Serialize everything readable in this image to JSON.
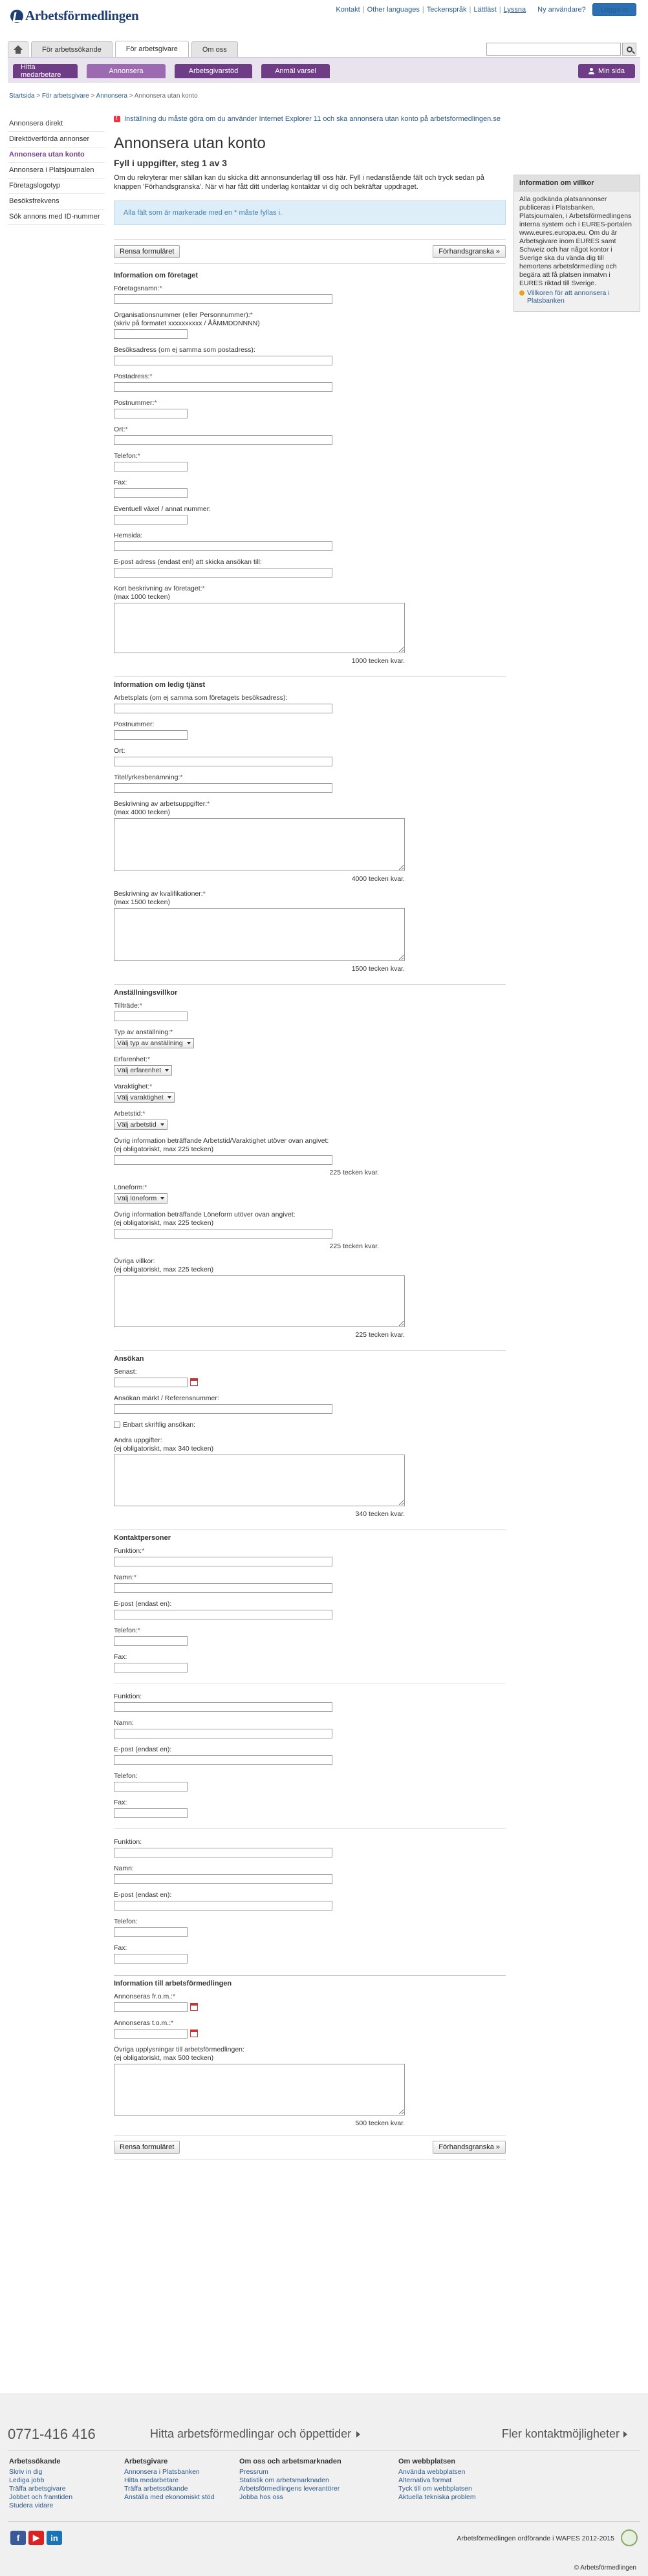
{
  "header": {
    "logo": "Arbetsförmedlingen",
    "links": [
      "Kontakt",
      "Other languages",
      "Teckenspråk",
      "Lättläst",
      "Lyssna"
    ],
    "user_link": "Ny användare?",
    "login": "Logga in"
  },
  "tabs": [
    {
      "label": "För arbetssökande"
    },
    {
      "label": "För arbetsgivare"
    },
    {
      "label": "Om oss"
    }
  ],
  "purple_nav": [
    "Hitta medarbetare",
    "Annonsera",
    "Arbetsgivarstöd",
    "Anmäl varsel"
  ],
  "mina_sida": "Min sida",
  "breadcrumb": [
    "Startsida",
    "För arbetsgivare",
    "Annonsera",
    "Annonsera utan konto"
  ],
  "sidebar": {
    "items": [
      {
        "label": "Annonsera direkt"
      },
      {
        "label": "Direktöverförda annonser"
      },
      {
        "label": "Annonsera utan konto"
      },
      {
        "label": "Annonsera i Platsjournalen"
      },
      {
        "label": "Företagslogotyp"
      },
      {
        "label": "Besöksfrekvens"
      },
      {
        "label": "Sök annons med ID-nummer"
      }
    ]
  },
  "ie_notice": "Inställning du måste göra om du använder Internet Explorer 11 och ska annonsera utan konto på arbetsformedlingen.se",
  "page": {
    "title": "Annonsera utan konto",
    "step": "Fyll i uppgifter, steg 1 av 3",
    "intro": "Om du rekryterar mer sällan kan du skicka ditt annonsunderlag till oss här. Fyll i nedanstående fält och tryck sedan på knappen 'Förhandsgranska'. När vi har fått ditt underlag kontaktar vi dig och bekräftar uppdraget.",
    "required_info": "Alla fält som är markerade med en * måste fyllas i.",
    "reset": "Rensa formuläret",
    "preview": "Förhandsgranska »"
  },
  "company": {
    "title": "Information om företaget",
    "name": "Företagsnamn:",
    "orgnr": "Organisationsnummer (eller Personnummer):",
    "orgnr_hint": "(skriv på formatet xxxxxxxxxx / ÅÅMMDDNNNN)",
    "visit_addr": "Besöksadress (om ej samma som postadress):",
    "post_addr": "Postadress:",
    "postnr": "Postnummer:",
    "ort": "Ort:",
    "phone": "Telefon:",
    "fax": "Fax:",
    "switch": "Eventuell växel / annat nummer:",
    "homepage": "Hemsida:",
    "email": "E-post adress (endast en!) att skicka ansökan till:",
    "desc": "Kort beskrivning av företaget:",
    "desc_hint": "(max 1000 tecken)",
    "desc_count": "1000 tecken kvar."
  },
  "job": {
    "title": "Information om ledig tjänst",
    "workplace": "Arbetsplats (om ej samma som företagets besöksadress):",
    "postnr": "Postnummer:",
    "ort": "Ort:",
    "jobtitle": "Titel/yrkesbenämning:",
    "tasks": "Beskrivning av arbetsuppgifter:",
    "tasks_hint": "(max 4000 tecken)",
    "tasks_count": "4000 tecken kvar.",
    "quals": "Beskrivning av kvalifikationer:",
    "quals_hint": "(max 1500 tecken)",
    "quals_count": "1500 tecken kvar."
  },
  "terms": {
    "title": "Anställningsvillkor",
    "start": "Tillträde:",
    "type": "Typ av anställning:",
    "type_sel": "Välj typ av anställning",
    "exp": "Erfarenhet:",
    "exp_sel": "Välj erfarenhet",
    "dur": "Varaktighet:",
    "dur_sel": "Välj varaktighet",
    "hours": "Arbetstid:",
    "hours_sel": "Välj arbetstid",
    "other_hours": "Övrig information beträffande Arbetstid/Varaktighet utöver ovan angivet:",
    "other_hours_hint": "(ej obligatoriskt, max 225 tecken)",
    "other_hours_count": "225 tecken kvar.",
    "pay": "Löneform:",
    "pay_sel": "Välj löneform",
    "other_pay": "Övrig information beträffande Löneform utöver ovan angivet:",
    "other_pay_hint": "(ej obligatoriskt, max 225 tecken)",
    "other_pay_count": "225 tecken kvar.",
    "other": "Övriga villkor:",
    "other_hint": "(ej obligatoriskt, max 225 tecken)",
    "other_count": "225 tecken kvar."
  },
  "application": {
    "title": "Ansökan",
    "last": "Senast:",
    "ref": "Ansökan märkt / Referensnummer:",
    "written": "Enbart skriftlig ansökan:",
    "other": "Andra uppgifter:",
    "other_hint": "(ej obligatoriskt, max 340 tecken)",
    "other_count": "340 tecken kvar."
  },
  "contacts": {
    "title": "Kontaktpersoner",
    "function": "Funktion:",
    "name": "Namn:",
    "email": "E-post (endast en):",
    "phone": "Telefon:",
    "fax": "Fax:"
  },
  "af_info": {
    "title": "Information till arbetsförmedlingen",
    "from": "Annonseras fr.o.m.:",
    "to": "Annonseras t.o.m.:",
    "other": "Övriga upplysningar till arbetsförmedlingen:",
    "other_hint": "(ej obligatoriskt, max 500 tecken)",
    "other_count": "500 tecken kvar."
  },
  "right_box": {
    "title": "Information om villkor",
    "body": "Alla godkända platsannonser publiceras i Platsbanken, Platsjournalen, i Arbetsförmedlingens interna system och i EURES-portalen www.eures.europa.eu. Om du är Arbetsgivare inom EURES samt Schweiz och har något kontor i Sverige ska du vända dig till hemortens arbetsförmedling och begära att få platsen inmatvn i EURES riktad till Sverige.",
    "link": "Villkoren för att annonsera i Platsbanken"
  },
  "footer": {
    "phone": "0771-416 416",
    "find": "Hitta arbetsförmedlingar och öppettider",
    "more": "Fler kontaktmöjligheter",
    "cols": [
      {
        "title": "Arbetssökande",
        "items": [
          "Skriv in dig",
          "Lediga jobb",
          "Träffa arbetsgivare",
          "Jobbet och framtiden",
          "Studera vidare"
        ]
      },
      {
        "title": "Arbetsgivare",
        "items": [
          "Annonsera i Platsbanken",
          "Hitta medarbetare",
          "Träffa arbetssökande",
          "Anställa med ekonomiskt stöd"
        ]
      },
      {
        "title": "Om oss och arbetsmarknaden",
        "items": [
          "Pressrum",
          "Statistik om arbetsmarknaden",
          "Arbetsförmedlingens leverantörer",
          "Jobba hos oss"
        ]
      },
      {
        "title": "Om webbplatsen",
        "items": [
          "Använda webbplatsen",
          "Alternativa format",
          "Tyck till om webbplatsen",
          "Aktuella tekniska problem"
        ]
      }
    ],
    "credit": "Arbetsförmedlingen ordförande i WAPES 2012-2015",
    "copyright": "© Arbetsförmedlingen"
  },
  "colors": {
    "purple": "#6f3c86",
    "link": "#2a5a8c",
    "info_bg": "#ddeef8"
  }
}
